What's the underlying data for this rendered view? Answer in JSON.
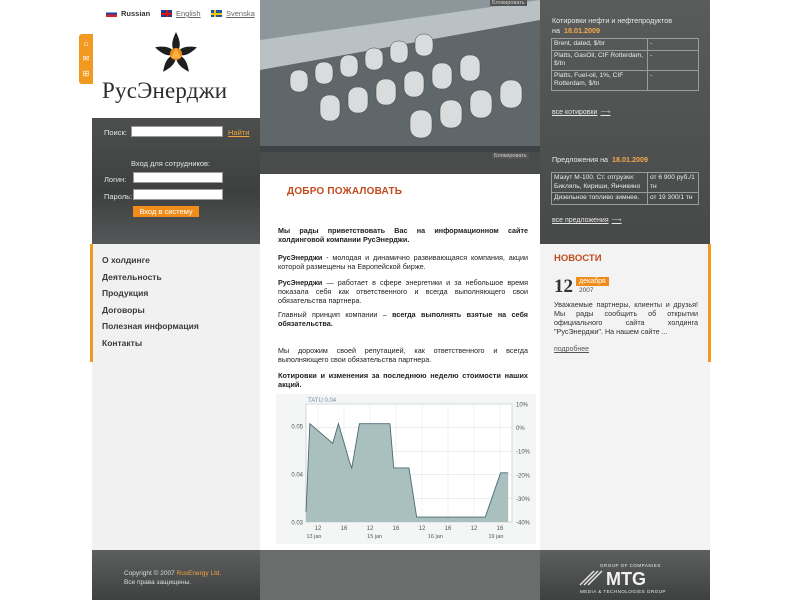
{
  "languages": [
    {
      "label": "Russian",
      "current": true
    },
    {
      "label": "English",
      "current": false
    },
    {
      "label": "Svenska",
      "current": false
    }
  ],
  "logo": {
    "text": "РусЭнерджи"
  },
  "photo": {
    "caption_top": "Блокировать",
    "caption_bottom": "Блокировать"
  },
  "search": {
    "label": "Поиск:",
    "go_label": "Найти",
    "value": ""
  },
  "login": {
    "title": "Вход для сотрудников:",
    "login_label": "Логин:",
    "password_label": "Пароль:",
    "submit_label": "Вход в систему"
  },
  "nav": {
    "items": [
      "О холдинге",
      "Деятельность",
      "Продукция",
      "Договоры",
      "Полезная информация",
      "Контакты"
    ]
  },
  "main": {
    "title": "ДОБРО ПОЖАЛОВАТЬ",
    "intro": "Мы рады приветствовать Вас на информационном сайте холдинговой компании РусЭнерджи.",
    "p1_brand": "РусЭнерджи",
    "p1_text": " - молодая и динамично развивающаяся компания, акции которой размещены на Европейской бирже.",
    "p2_brand": "РусЭнерджи",
    "p2_text": " — работает в сфере энергетики и за небольшое время показала себя как ответственного и всегда выполняющего свои обязательства партнера.",
    "p3_text": "Главный принцип компании – ",
    "p3_bold": "всегда выполнять взятые на себя обязательства.",
    "p4_text": "Мы дорожим своей репутацией, как ответственного и всегда выполняющего свои обязательства партнера.",
    "chart_heading": "Котировки и изменения за последнюю неделю стоимости наших акций."
  },
  "chart_data": {
    "type": "area",
    "title": "TATU 0.04",
    "x_tick_labels": [
      "12",
      "16",
      "12",
      "16",
      "12",
      "16",
      "12",
      "16"
    ],
    "x_date_labels": [
      "13 jan",
      "15 jan",
      "16 jan",
      "19 jan"
    ],
    "y_left_ticks": [
      "0.05",
      "0.04",
      "0.03"
    ],
    "y_right_ticks": [
      "10%",
      "0%",
      "-10%",
      "-20%",
      "-30%",
      "-40%"
    ],
    "ylim": [
      0.03,
      0.054
    ],
    "x": [
      0,
      2,
      14,
      17,
      23,
      24,
      28,
      44,
      46,
      54,
      58,
      67,
      68,
      78,
      82,
      94,
      102,
      104,
      106
    ],
    "values": [
      0.032,
      0.05,
      0.046,
      0.05,
      0.042,
      0.041,
      0.05,
      0.05,
      0.041,
      0.041,
      0.031,
      0.031,
      0.031,
      0.031,
      0.031,
      0.031,
      0.04,
      0.04,
      0.04
    ],
    "xlim": [
      0,
      108
    ],
    "grid": true,
    "colors": {
      "fill": "#a9c0bf",
      "line": "#4a6a74"
    }
  },
  "quotes": {
    "title": "Котировки нефти и нефтепродуктов",
    "on": "на",
    "date": "18.01.2009",
    "rows": [
      {
        "name": "Brent, dated, $/br",
        "value": "-"
      },
      {
        "name": "Platts, GasOil, CIF Rotterdam, $/tn",
        "value": "-"
      },
      {
        "name": "Platts, Fuel-oil, 1%, CIF Rotterdam, $/tn",
        "value": "-"
      }
    ],
    "all_label": "все котировки"
  },
  "offers": {
    "title": "Предложения на",
    "date": "18.01.2009",
    "rows": [
      {
        "name": "Мазут М-100. Ст. отгрузки: Бикляль, Кириши, Янчикино",
        "value": "от 6 900 руб./1 тн"
      },
      {
        "name": "Дизельное топливо зимнее.",
        "value": "от 19 300/1 тн"
      }
    ],
    "all_label": "все предложения"
  },
  "news": {
    "title": "НОВОСТИ",
    "day": "12",
    "month": "декабря",
    "year": "2007",
    "text": "Уважаемые партнеры, клиенты и друзья! Мы рады сообщить об открытии официального сайта холдинга \"РусЭнерджи\". На нашем сайте ...",
    "more_label": "подробнее"
  },
  "footer": {
    "copyright_prefix": "Copyright © 2007",
    "copyright_brand": "RusEnergy Ltd.",
    "rights": "Все права защищены.",
    "mtg_logo": "MTG",
    "mtg_top": "GROUP OF COMPANIES",
    "mtg_bottom": "MEDIA & TECHNOLOGIES GROUP"
  },
  "colors": {
    "accent": "#f08c1a",
    "title": "#c14b1e"
  }
}
